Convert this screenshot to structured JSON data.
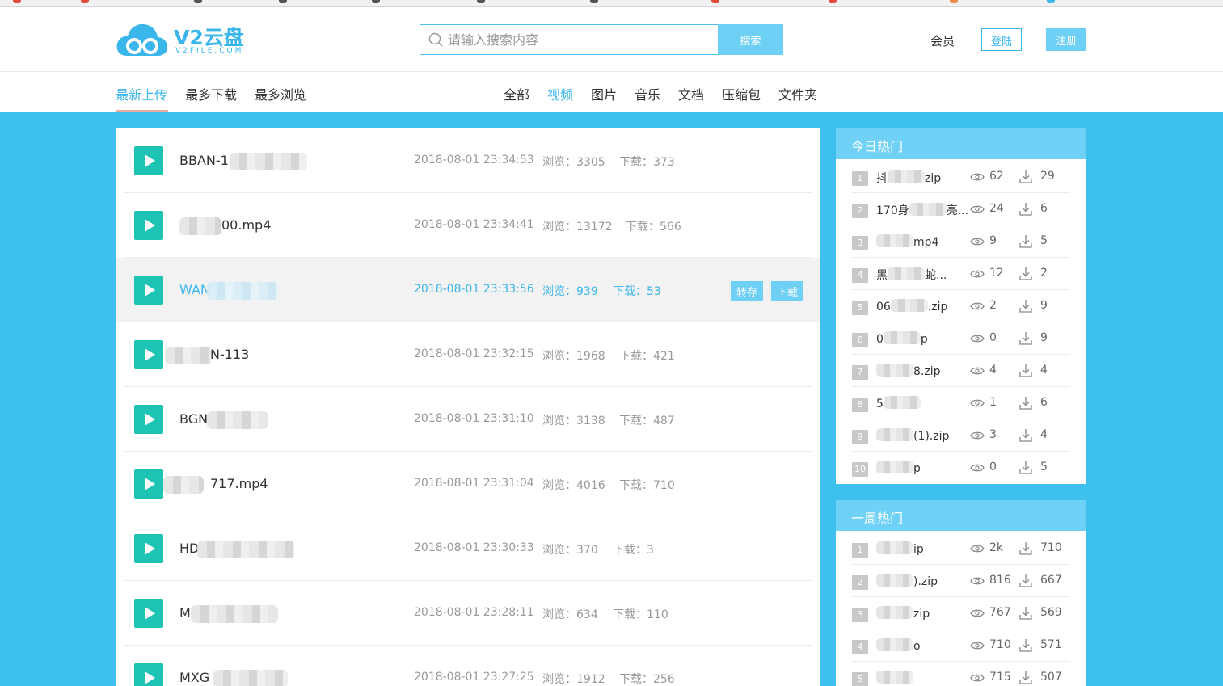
{
  "header": {
    "logo_text": "V2云盘",
    "logo_sub": "V2FILE.COM",
    "search_placeholder": "请输入搜索内容",
    "search_button": "搜索",
    "member": "会员",
    "login": "登陆",
    "register": "注册",
    "colors": {
      "accent": "#3ab6eb",
      "button": "#6fd0f5",
      "background": "#3ec0ef",
      "play": "#1dc4b4"
    }
  },
  "nav": {
    "sort_tabs": [
      "最新上传",
      "最多下载",
      "最多浏览"
    ],
    "type_tabs": [
      "全部",
      "视频",
      "图片",
      "音乐",
      "文档",
      "压缩包",
      "文件夹"
    ],
    "active_sort": "最新上传",
    "active_type": "视频"
  },
  "files": [
    {
      "name": "BBAN-1",
      "date": "2018-08-01 23:34:53",
      "views": "浏览：3305",
      "downloads": "下载：373"
    },
    {
      "name": "00.mp4",
      "date": "2018-08-01 23:34:41",
      "views": "浏览：13172",
      "downloads": "下载：566"
    },
    {
      "name": "WAN",
      "date": "2018-08-01 23:33:56",
      "views": "浏览：939",
      "downloads": "下载：53",
      "save_label": "转存",
      "download_label": "下载"
    },
    {
      "name": "N-113",
      "date": "2018-08-01 23:32:15",
      "views": "浏览：1968",
      "downloads": "下载：421"
    },
    {
      "name": "BGN",
      "date": "2018-08-01 23:31:10",
      "views": "浏览：3138",
      "downloads": "下载：487"
    },
    {
      "name": "717.mp4",
      "date": "2018-08-01 23:31:04",
      "views": "浏览：4016",
      "downloads": "下载：710"
    },
    {
      "name": "HD",
      "date": "2018-08-01 23:30:33",
      "views": "浏览：370",
      "downloads": "下载：3"
    },
    {
      "name": "M",
      "date": "2018-08-01 23:28:11",
      "views": "浏览：634",
      "downloads": "下载：110"
    },
    {
      "name": "MXG",
      "date": "2018-08-01 23:27:25",
      "views": "浏览：1912",
      "downloads": "下载：256"
    }
  ],
  "today_hot": {
    "title": "今日热门",
    "items": [
      {
        "rank": "1",
        "name": "抖",
        "tail": "zip",
        "views": "62",
        "downloads": "29"
      },
      {
        "rank": "2",
        "name": "170身",
        "tail": "亮...",
        "views": "24",
        "downloads": "6"
      },
      {
        "rank": "3",
        "name": "",
        "tail": "mp4",
        "views": "9",
        "downloads": "5"
      },
      {
        "rank": "4",
        "name": "黑",
        "tail": "蛇...",
        "views": "12",
        "downloads": "2"
      },
      {
        "rank": "5",
        "name": "06",
        "tail": ".zip",
        "views": "2",
        "downloads": "9"
      },
      {
        "rank": "6",
        "name": "0",
        "tail": "p",
        "views": "0",
        "downloads": "9"
      },
      {
        "rank": "7",
        "name": "",
        "tail": "8.zip",
        "views": "4",
        "downloads": "4"
      },
      {
        "rank": "8",
        "name": "5",
        "tail": "",
        "views": "1",
        "downloads": "6"
      },
      {
        "rank": "9",
        "name": "",
        "tail": "(1).zip",
        "views": "3",
        "downloads": "4"
      },
      {
        "rank": "10",
        "name": "",
        "tail": "p",
        "views": "0",
        "downloads": "5"
      }
    ]
  },
  "week_hot": {
    "title": "一周热门",
    "items": [
      {
        "rank": "1",
        "name": "",
        "tail": "ip",
        "views": "2k",
        "downloads": "710"
      },
      {
        "rank": "2",
        "name": "",
        "tail": ").zip",
        "views": "816",
        "downloads": "667"
      },
      {
        "rank": "3",
        "name": "",
        "tail": "zip",
        "views": "767",
        "downloads": "569"
      },
      {
        "rank": "4",
        "name": "",
        "tail": "o",
        "views": "710",
        "downloads": "571"
      },
      {
        "rank": "5",
        "name": "",
        "tail": "",
        "views": "715",
        "downloads": "507"
      }
    ]
  }
}
